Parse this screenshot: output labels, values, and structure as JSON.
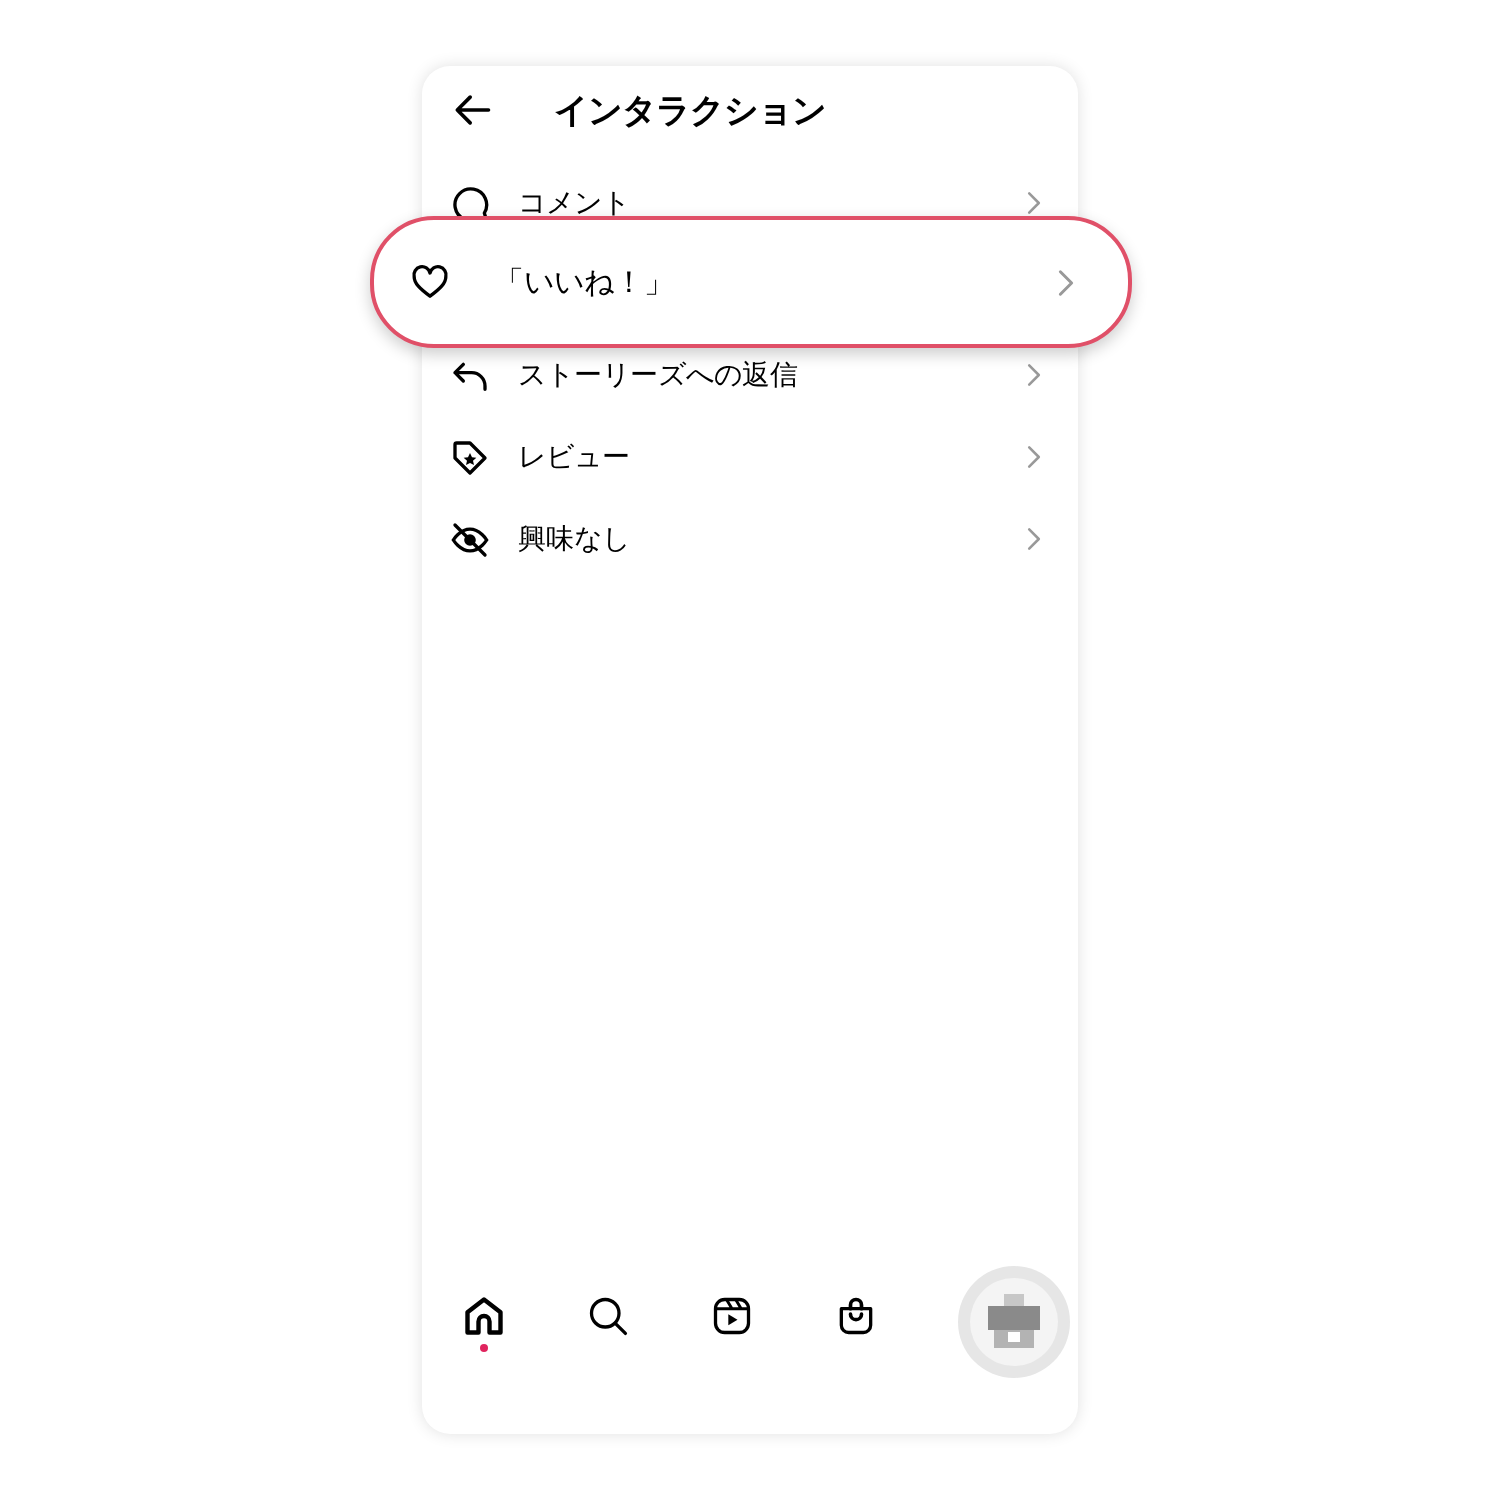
{
  "header": {
    "title": "インタラクション"
  },
  "items": [
    {
      "kind": "comment",
      "label": "コメント",
      "highlighted": false
    },
    {
      "kind": "heart",
      "label": "「いいね！」",
      "highlighted": true
    },
    {
      "kind": "reply",
      "label": "ストーリーズへの返信",
      "highlighted": false
    },
    {
      "kind": "tag",
      "label": "レビュー",
      "highlighted": false
    },
    {
      "kind": "eye-off",
      "label": "興味なし",
      "highlighted": false
    }
  ],
  "nav": [
    {
      "kind": "home",
      "selected": true
    },
    {
      "kind": "search",
      "selected": false
    },
    {
      "kind": "reels",
      "selected": false
    },
    {
      "kind": "shop",
      "selected": false
    },
    {
      "kind": "avatar",
      "selected": false
    }
  ]
}
